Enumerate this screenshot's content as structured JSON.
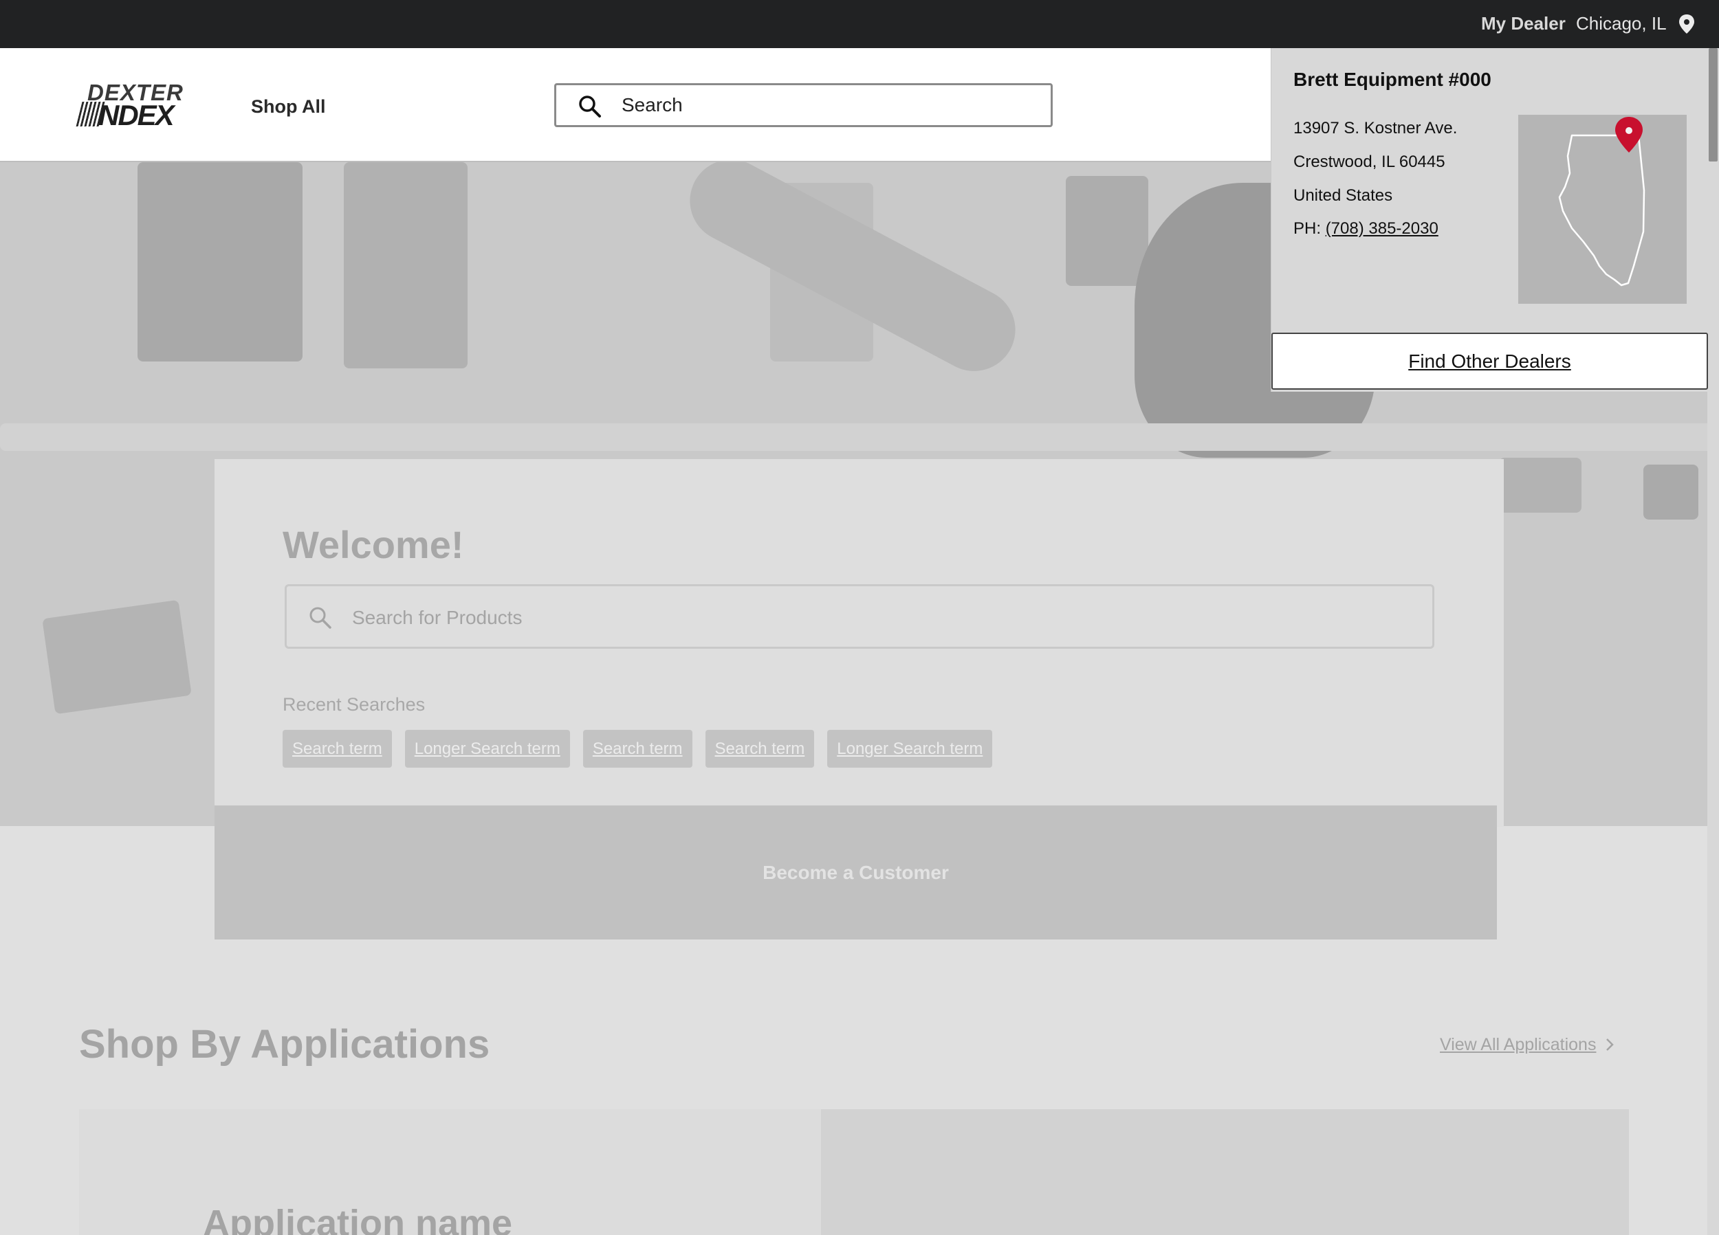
{
  "topbar": {
    "dealer_label": "My Dealer",
    "dealer_city": "Chicago, IL",
    "pin_icon": "location-pin-icon"
  },
  "header": {
    "logo_line1": "DEXTER",
    "logo_line2": "NDEX",
    "shop_all": "Shop All",
    "search_placeholder": "Search"
  },
  "welcome": {
    "title": "Welcome!",
    "search_placeholder": "Search for Products",
    "recent_label": "Recent Searches",
    "recent_searches": [
      "Search term",
      "Longer Search term",
      "Search term",
      "Search term",
      "Longer Search term"
    ]
  },
  "become_customer": "Become a Customer",
  "applications": {
    "title": "Shop By Applications",
    "view_all": "View All Applications",
    "card_name": "Application name"
  },
  "dealer_popup": {
    "name": "Brett Equipment #000",
    "address_line1": "13907 S. Kostner Ave.",
    "address_line2": "Crestwood, IL 60445",
    "country": "United States",
    "phone_prefix": "PH:",
    "phone": "(708) 385-2030",
    "find_button": "Find Other Dealers",
    "map_marker_color": "#c8102e"
  }
}
